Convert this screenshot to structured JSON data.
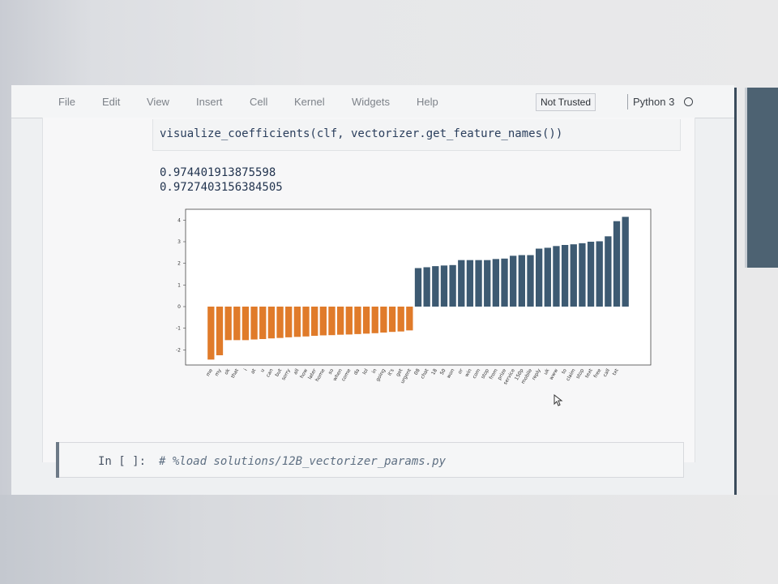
{
  "menubar": {
    "items": [
      "File",
      "Edit",
      "View",
      "Insert",
      "Cell",
      "Kernel",
      "Widgets",
      "Help"
    ],
    "trust_status": "Not Trusted",
    "kernel_name": "Python 3",
    "kernel_indicator_icon": "kernel-idle-circle-icon"
  },
  "cells": {
    "code_cell": {
      "source": "visualize_coefficients(clf, vectorizer.get_feature_names())"
    },
    "outputs": [
      "0.974401913875598",
      "0.9727403156384505"
    ],
    "input_cell": {
      "prompt": "In [ ]:",
      "source": "# %load solutions/12B_vectorizer_params.py"
    }
  },
  "chart_data": {
    "type": "bar",
    "yticks": [
      "4",
      "3",
      "2",
      "1",
      "0",
      "-1",
      "-2"
    ],
    "ylim": [
      -2.7,
      4.5
    ],
    "colors": {
      "negative": "#e07b2a",
      "positive": "#3d5a72"
    },
    "categories": [
      "me",
      "my",
      "ok",
      "that",
      "i",
      "at",
      "u",
      "can",
      "but",
      "sorry",
      "all",
      "how",
      "later",
      "home",
      "so",
      "when",
      "come",
      "da",
      "lol",
      "in",
      "going",
      "it's",
      "get",
      "urgent",
      "08",
      "chat",
      "18",
      "50",
      "won",
      "or",
      "win",
      "com",
      "stop",
      "from",
      "prize",
      "service",
      "150p",
      "mobile",
      "reply",
      "uk",
      "www",
      "to",
      "claim",
      "stop",
      "text",
      "free",
      "call",
      "txt"
    ],
    "values": [
      -2.45,
      -2.25,
      -1.55,
      -1.55,
      -1.55,
      -1.52,
      -1.5,
      -1.47,
      -1.45,
      -1.42,
      -1.4,
      -1.38,
      -1.35,
      -1.33,
      -1.32,
      -1.3,
      -1.29,
      -1.27,
      -1.25,
      -1.23,
      -1.2,
      -1.17,
      -1.15,
      -1.1,
      1.78,
      1.82,
      1.87,
      1.9,
      1.92,
      2.15,
      2.15,
      2.15,
      2.15,
      2.2,
      2.22,
      2.35,
      2.38,
      2.38,
      2.68,
      2.72,
      2.8,
      2.85,
      2.88,
      2.93,
      3.0,
      3.02,
      3.25,
      3.95,
      4.15
    ]
  }
}
